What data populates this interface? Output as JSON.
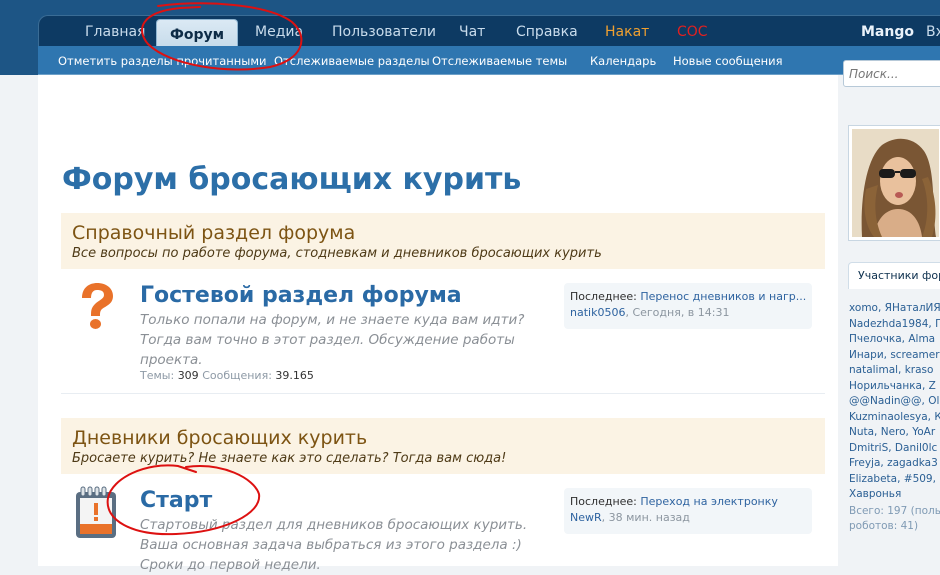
{
  "nav": {
    "tabs": [
      {
        "label": "Главная"
      },
      {
        "label": "Форум"
      },
      {
        "label": "Медиа"
      },
      {
        "label": "Пользователи"
      },
      {
        "label": "Чат"
      },
      {
        "label": "Справка"
      },
      {
        "label": "Накат"
      },
      {
        "label": "СОС"
      }
    ],
    "user": "Mango",
    "login_cut": "Вх"
  },
  "subnav": [
    {
      "label": "Отметить разделы прочитанными"
    },
    {
      "label": "Отслеживаемые разделы"
    },
    {
      "label": "Отслеживаемые темы"
    },
    {
      "label": "Календарь"
    },
    {
      "label": "Новые сообщения"
    }
  ],
  "search": {
    "placeholder": "Поиск..."
  },
  "page_title": "Форум бросающих курить",
  "categories": [
    {
      "title": "Справочный раздел форума",
      "description": "Все вопросы по работе форума, стодневкам и дневников бросающих курить",
      "node": {
        "title": "Гостевой раздел форума",
        "description_lines": [
          "Только попали на форум, и не знаете куда вам идти?",
          "Тогда вам точно в этот раздел. Обсуждение работы",
          "проекта."
        ],
        "stats": {
          "threads_label": "Темы:",
          "threads": "309",
          "messages_label": "Сообщения:",
          "messages": "39.165"
        },
        "last": {
          "label": "Последнее:",
          "title": "Перенос дневников и нагр...",
          "user": "natik0506",
          "time": ", Сегодня, в 14:31"
        }
      }
    },
    {
      "title": "Дневники бросающих курить",
      "description": "Бросаете курить? Не знаете как это сделать? Тогда вам сюда!",
      "node": {
        "title": "Старт",
        "description_lines": [
          "Стартовый раздел для дневников бросающих курить.",
          "Ваша основная задача выбраться из этого раздела :)",
          "Сроки до первой недели."
        ],
        "last": {
          "label": "Последнее:",
          "title": "Переход на электронку",
          "user": "NewR",
          "time": ", 38 мин. назад"
        }
      }
    }
  ],
  "sidebar": {
    "members_title": "Участники фор",
    "member_lines": [
      "xomo, ЯНаталИЯ",
      "Nadezhda1984, Г",
      "Пчелочка, Alma",
      "Инари, screamer",
      "natalimal, kraso",
      "Норильчанка, Z",
      "@@Nadin@@, Ola",
      "Kuzminaolesya, К",
      "Nuta, Nero, YoAr",
      "DmitriS, Danil0lc",
      "Freyja, zagadka3",
      "Elizabeta, #509,",
      "Хавронья"
    ],
    "stats_lines": [
      "Всего: 197 (полы",
      "роботов: 41)"
    ]
  },
  "colors": {
    "nav_bg": "#0d3a63",
    "subnav_bg": "#2f76b0",
    "accent_title": "#2c6fa8",
    "category_bg": "#fbf3e4",
    "category_title": "#7d5413",
    "nakat": "#f0a030",
    "sos": "#e02020",
    "annotation_red": "#dd1111"
  },
  "icons": {
    "guest_node": "question-mark-icon",
    "start_node": "notepad-alert-icon"
  }
}
